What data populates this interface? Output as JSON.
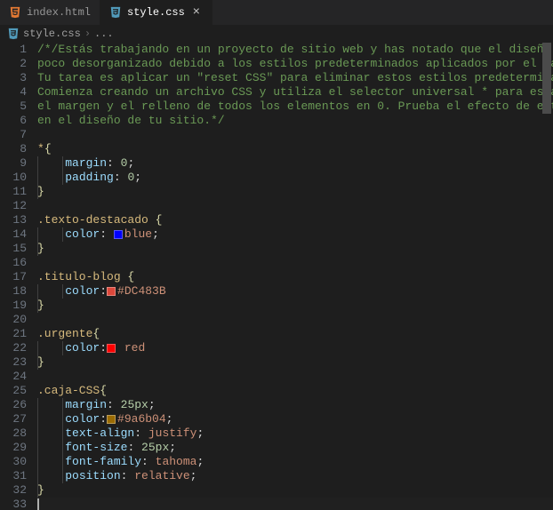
{
  "tabs": [
    {
      "label": "index.html",
      "icon": "html-icon",
      "active": false
    },
    {
      "label": "style.css",
      "icon": "css-icon",
      "active": true
    }
  ],
  "breadcrumb": {
    "file": "style.css",
    "more": "..."
  },
  "colors": {
    "blue": "#0000ff",
    "dc483b": "#DC483B",
    "red": "#ff0000",
    "gold": "#9a6b04"
  },
  "code": {
    "c1": "/*/Estás trabajando en un proyecto de sitio web y has notado que el diseño está un",
    "c2": "poco desorganizado debido a los estilos predeterminados aplicados por el navegador.",
    "c3": "Tu tarea es aplicar un \"reset CSS\" para eliminar estos estilos predeterminados.",
    "c4": "Comienza creando un archivo CSS y utiliza el selector universal * para establecer",
    "c5": "el margen y el relleno de todos los elementos en 0. Prueba el efecto de este cambio",
    "c6": "en el diseño de tu sitio.*/",
    "s1": "*",
    "ob": "{",
    "cb": "}",
    "p_margin": "margin",
    "p_padding": "padding",
    "p_color": "color",
    "p_textalign": "text-align",
    "p_fontsize": "font-size",
    "p_fontfam": "font-family",
    "p_position": "position",
    "v_zero": "0",
    "v_blue": "blue",
    "v_dc": "#DC483B",
    "v_red": "red",
    "v_25px": "25px",
    "v_gold": "#9a6b04",
    "v_justify": "justify",
    "v_tahoma": "tahoma",
    "v_relative": "relative",
    "sel_texto": ".texto-destacado ",
    "sel_titulo": ".titulo-blog ",
    "sel_urgente": ".urgente",
    "sel_caja": ".caja-CSS",
    "colon": ":",
    "semi": ";"
  }
}
